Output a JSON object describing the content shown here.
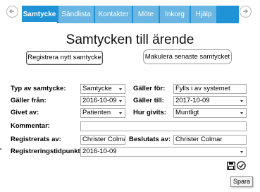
{
  "nav": {
    "tabs": [
      {
        "label": "Samtycke",
        "active": true
      },
      {
        "label": "Sändlista",
        "active": false
      },
      {
        "label": "Kontakter",
        "active": false
      },
      {
        "label": "Möte",
        "active": false
      },
      {
        "label": "Inkorg",
        "active": false
      },
      {
        "label": "Hjälp",
        "active": false
      }
    ],
    "back_icon": "circle-arrow-left-icon",
    "forward_icon": "circle-arrow-right-icon"
  },
  "page": {
    "title": "Samtycken till ärende",
    "register_button": "Registrera nytt samtycke",
    "cancel_button": "Makulera senaste samtycket"
  },
  "form": {
    "typ_label": "Typ av samtycke:",
    "typ_value": "Samtycke",
    "galler_for_label": "Gäller för:",
    "galler_for_value": "Fylls i av systemet",
    "galler_fran_label": "Gäller från:",
    "galler_fran_value": "2016-10-09",
    "galler_till_label": "Gäller till:",
    "galler_till_value": "2017-10-09",
    "givet_av_label": "Givet av:",
    "givet_av_value": "Patienten",
    "hur_givits_label": "Hur givits:",
    "hur_givits_value": "Muntligt",
    "kommentar_label": "Kommentar:",
    "kommentar_value": "",
    "registrerats_av_label": "Registrerats av:",
    "registrerats_av_value": "Christer Colmar",
    "beslutats_av_label": "Beslutats av:",
    "beslutats_av_value": "Christer Colmar",
    "registreringstidpunkt_label": "Registreringstidpunkt:",
    "registreringstidpunkt_value": "2016-10-09"
  },
  "actions": {
    "save_icon": "floppy-disk-icon",
    "confirm_icon": "check-circle-icon",
    "tooltip": "Spara"
  },
  "colors": {
    "tab_active": "#1f93d6",
    "tab_inactive": "#6ab6e3",
    "tab_text": "#ffffff"
  }
}
